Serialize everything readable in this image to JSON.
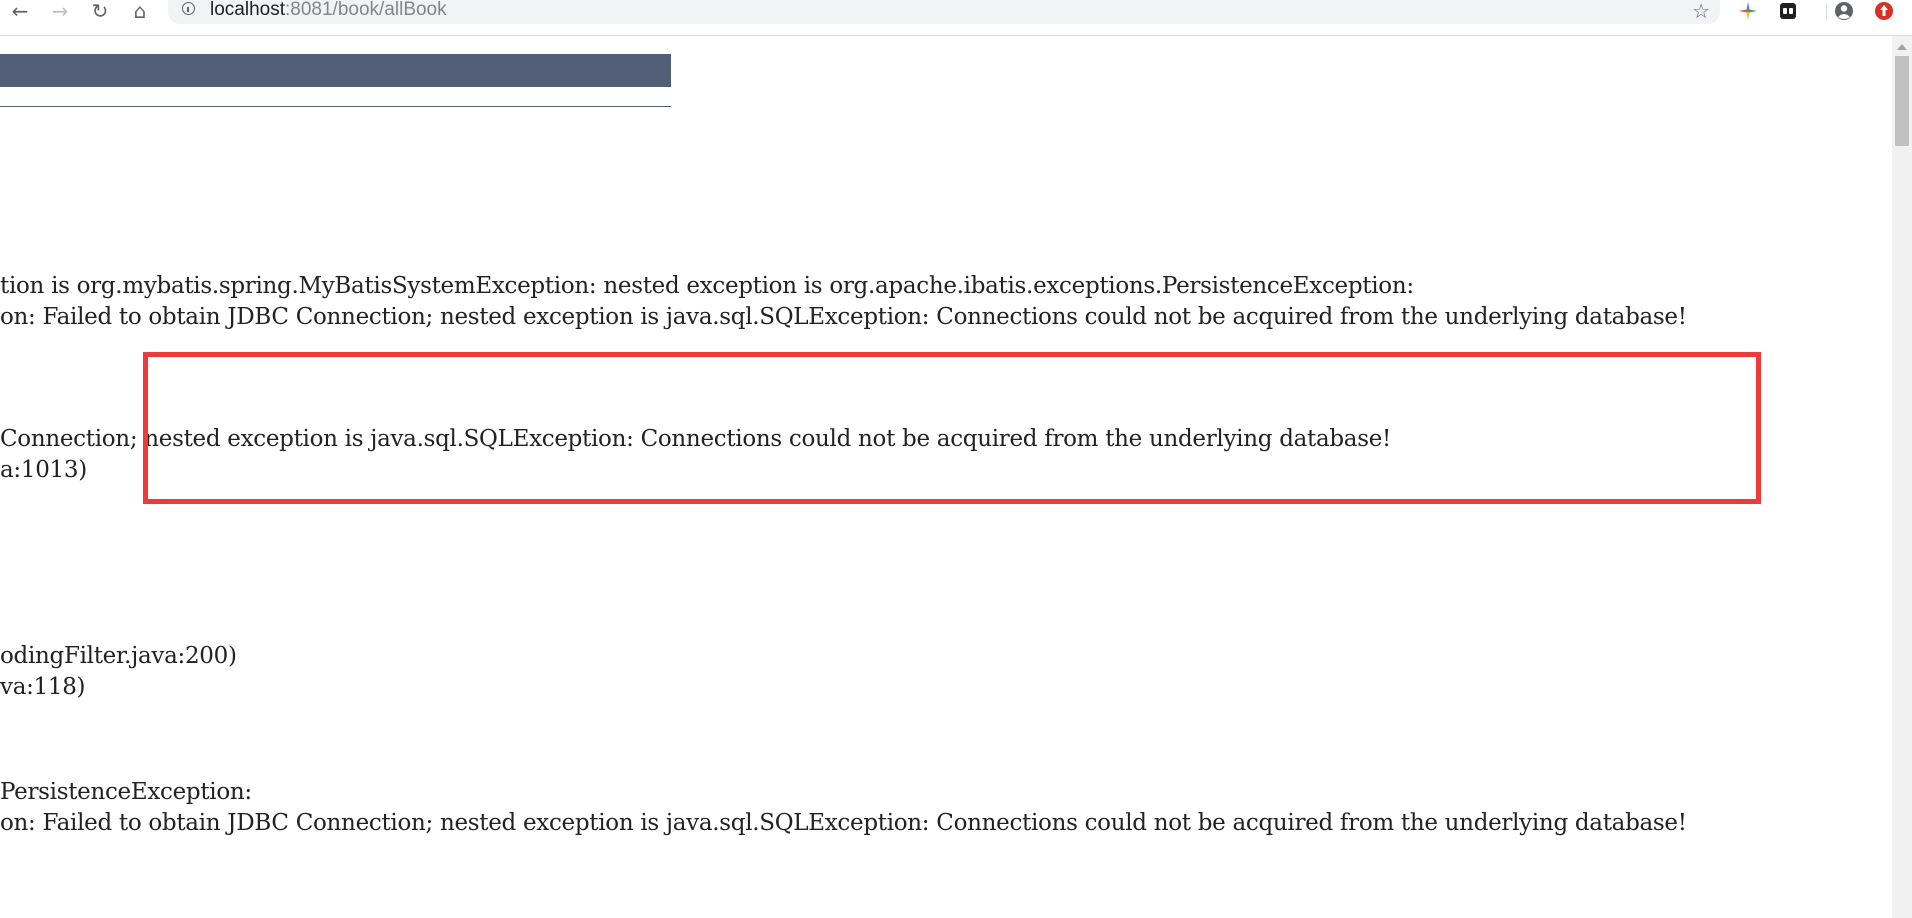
{
  "browser": {
    "back_glyph": "←",
    "forward_glyph": "→",
    "reload_glyph": "↻",
    "home_glyph": "⌂",
    "url_host": "localhost",
    "url_rest": ":8081/book/allBook",
    "bookmark_glyph": "☆",
    "icons": [
      "arrow-left-icon",
      "arrow-right-icon",
      "reload-icon",
      "home-icon",
      "info-icon",
      "star-icon",
      "extension-icon",
      "profile-icon",
      "update-icon"
    ]
  },
  "page": {
    "lines": [
      "tion is org.mybatis.spring.MyBatisSystemException: nested exception is org.apache.ibatis.exceptions.PersistenceException:",
      "on: Failed to obtain JDBC Connection; nested exception is java.sql.SQLException: Connections could not be acquired from the underlying database!",
      "Connection; nested exception is java.sql.SQLException: Connections could not be acquired from the underlying database!",
      "a:1013)",
      "odingFilter.java:200)",
      "va:118)",
      "PersistenceException:",
      "on: Failed to obtain JDBC Connection; nested exception is java.sql.SQLException: Connections could not be acquired from the underlying database!"
    ]
  },
  "colors": {
    "header": "#525d76",
    "highlight": "#ee3a3a"
  }
}
